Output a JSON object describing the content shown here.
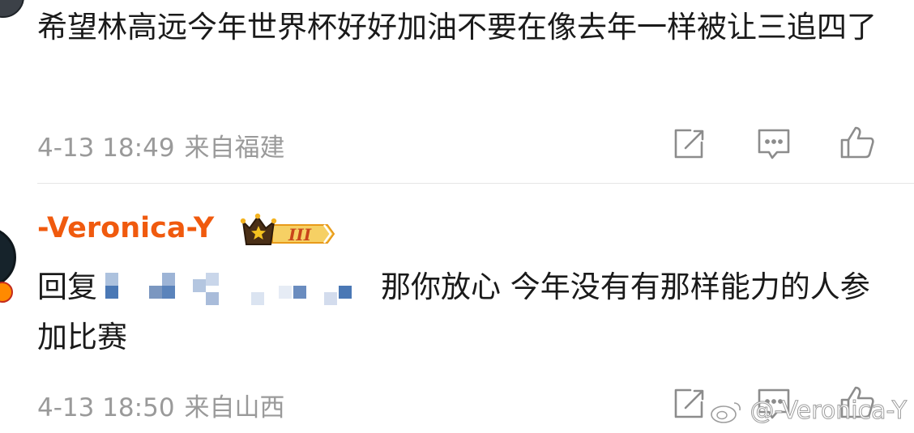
{
  "comments": [
    {
      "text": "希望林高远今年世界杯好好加油不要在像去年一样被让三追四了",
      "date": "4-13 18:49",
      "location": "来自福建"
    },
    {
      "username": "-Veronica-Y",
      "badge_level": "III",
      "reply_prefix": "回复",
      "text_after_mention": "那你放心 今年没有有那样能力的人参加比赛",
      "date": "4-13 18:50",
      "location": "来自山西"
    }
  ],
  "actions": {
    "share_icon": "share-edit-icon",
    "comment_icon": "comment-bubble-icon",
    "like_icon": "thumbs-up-icon"
  },
  "watermark": "@-Veronica-Y",
  "colors": {
    "username": "#f05a0e",
    "meta": "#9a9a9a",
    "text": "#1a1a1a",
    "badge_gold": "#f4b320",
    "blur_blue": "#4a78b5"
  }
}
